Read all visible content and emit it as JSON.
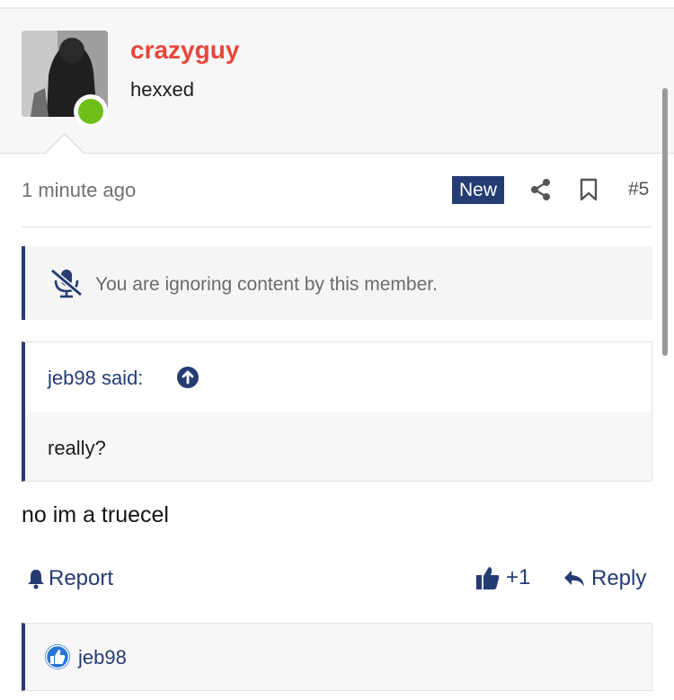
{
  "post": {
    "author": "crazyguy",
    "author_title": "hexxed",
    "timestamp": "1 minute ago",
    "new_badge": "New",
    "post_number": "#5",
    "ignore_notice": "You are ignoring content by this member.",
    "quote": {
      "header": "jeb98 said:",
      "text": "really?"
    },
    "message": "no im a truecel",
    "actions": {
      "report": "Report",
      "like_count": "+1",
      "reply": "Reply"
    },
    "reactions": {
      "users": "jeb98"
    }
  },
  "colors": {
    "username": "#e8463b",
    "accent": "#253c73",
    "online": "#6fbf1a"
  },
  "icons": [
    "share-icon",
    "bookmark-icon",
    "mute-icon",
    "arrow-up-circle-icon",
    "bell-icon",
    "thumbs-up-icon",
    "reply-arrow-icon",
    "like-reaction-icon"
  ]
}
